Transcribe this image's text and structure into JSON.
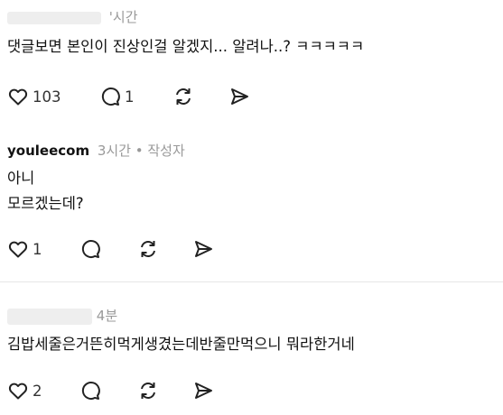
{
  "comments": [
    {
      "username": "",
      "time": "'시간",
      "text_lines": [
        "댓글보면 본인이 진상인걸 알겠지... 알려나..? ㅋㅋㅋㅋㅋ"
      ],
      "like_count": "103",
      "reply_count": "1"
    },
    {
      "username": "youleecom",
      "time": "3시간 • 작성자",
      "text_lines": [
        "아니",
        "모르겠는데?"
      ],
      "like_count": "1",
      "reply_count": ""
    },
    {
      "username": "",
      "time": "4분",
      "text_lines": [
        "김밥세줄은거뜬히먹게생겼는데반줄만먹으니 뭐라한거네"
      ],
      "like_count": "2",
      "reply_count": ""
    }
  ]
}
